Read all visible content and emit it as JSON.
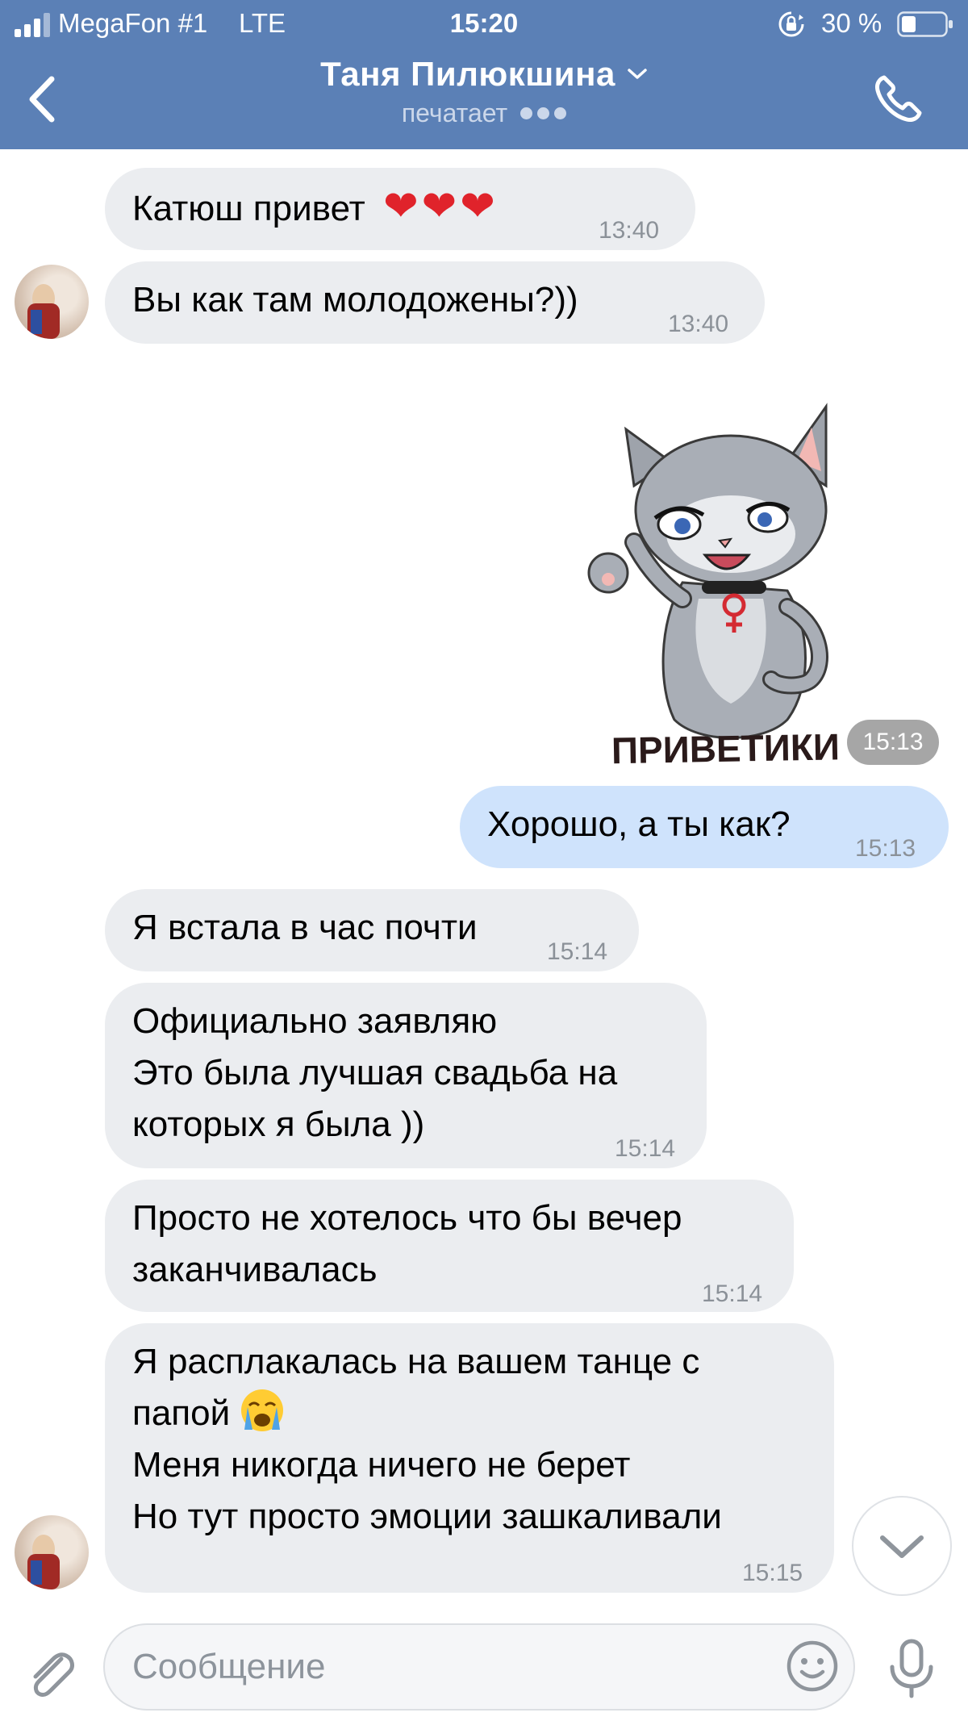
{
  "status_bar": {
    "carrier": "MegaFon #1",
    "network": "LTE",
    "time": "15:20",
    "battery_percent": "30 %"
  },
  "header": {
    "contact_name": "Таня Пилюкшина",
    "status": "печатает",
    "icons": [
      "back-arrow-icon",
      "chevron-down-icon",
      "phone-icon"
    ]
  },
  "messages": [
    {
      "direction": "in",
      "text": "Катюш привет",
      "hearts": "❤❤❤",
      "time": "13:40"
    },
    {
      "direction": "in",
      "text": "Вы как там молодожены?))",
      "time": "13:40"
    },
    {
      "direction": "out",
      "type": "sticker",
      "caption": "ПРИВЕТИКИ",
      "time": "15:13"
    },
    {
      "direction": "out",
      "text": "Хорошо, а ты как?",
      "time": "15:13"
    },
    {
      "direction": "in",
      "text": "Я встала в час почти",
      "time": "15:14"
    },
    {
      "direction": "in",
      "lines": [
        "Официально заявляю",
        "Это была лучшая свадьба на",
        "которых я была ))"
      ],
      "time": "15:14"
    },
    {
      "direction": "in",
      "lines": [
        "Просто не хотелось что бы вечер",
        "заканчивалась"
      ],
      "time": "15:14"
    },
    {
      "direction": "in",
      "lines": [
        "Я расплакалась на вашем танце с",
        "папой",
        "Меня никогда ничего не берет",
        "Но тут просто эмоции зашкаливали"
      ],
      "time": "15:15"
    }
  ],
  "composer": {
    "placeholder": "Сообщение",
    "icons": [
      "paperclip-icon",
      "smile-icon",
      "microphone-icon"
    ]
  },
  "colors": {
    "header_bg": "#5b80b6",
    "incoming_bubble": "#ebedf0",
    "outgoing_bubble": "#cfe3fc",
    "heart": "#e0232b"
  }
}
